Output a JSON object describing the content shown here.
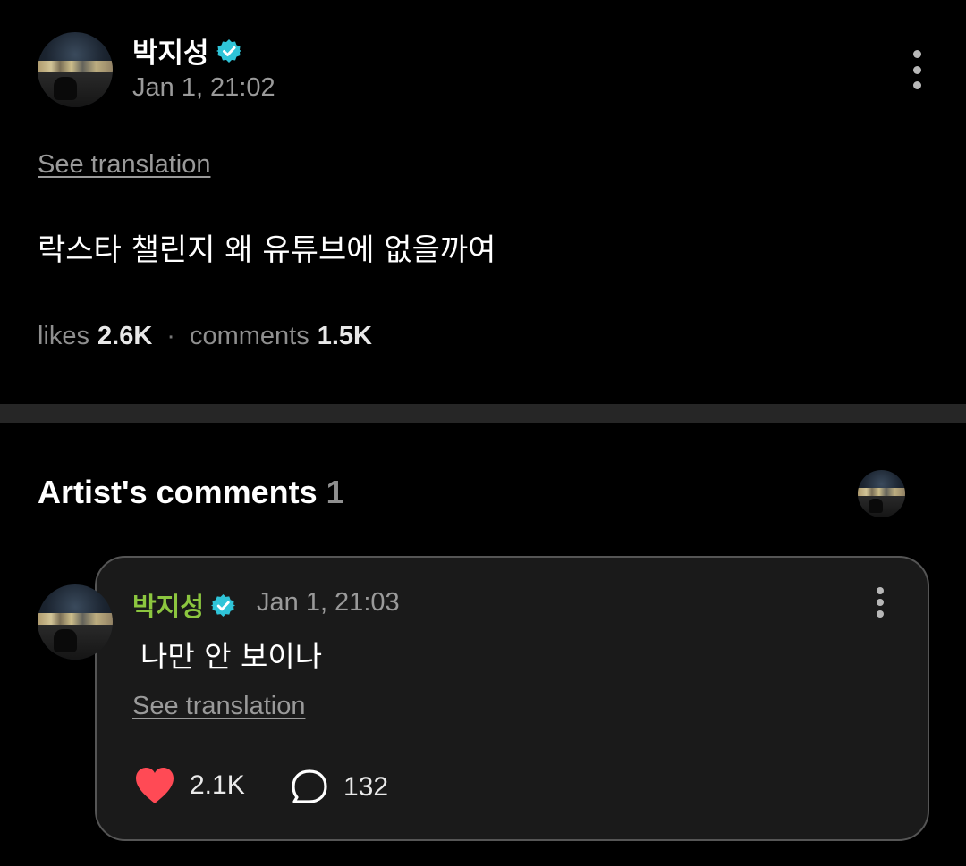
{
  "post": {
    "author": "박지성",
    "timestamp": "Jan 1, 21:02",
    "see_translation": "See translation",
    "body": "락스타 챌린지 왜 유튜브에 없을까여",
    "likes_label": "likes",
    "likes_count": "2.6K",
    "separator": "·",
    "comments_label": "comments",
    "comments_count": "1.5K"
  },
  "artist_comments": {
    "title": "Artist's comments",
    "count": "1"
  },
  "comment": {
    "author": "박지성",
    "timestamp": "Jan 1, 21:03",
    "text": "나만 안 보이나",
    "see_translation": "See translation",
    "like_count": "2.1K",
    "reply_count": "132"
  },
  "colors": {
    "background": "#000000",
    "verified_badge": "#2fc4d8",
    "comment_author": "#8cc63f",
    "heart": "#ff4a55",
    "card_border": "#555555"
  },
  "icons": {
    "verified": "verified-badge-icon",
    "more": "kebab-menu-icon",
    "like": "heart-icon",
    "reply": "speech-bubble-icon"
  }
}
